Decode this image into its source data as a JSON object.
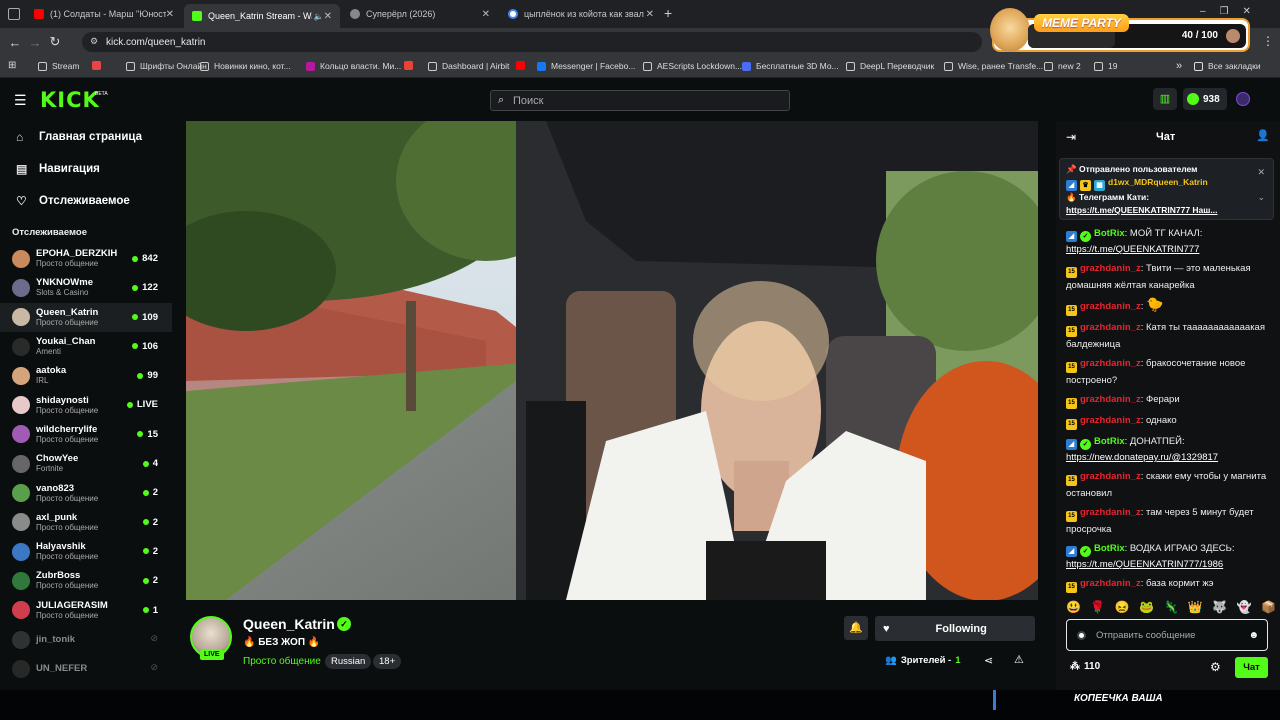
{
  "browser": {
    "tabs": [
      {
        "label": "(1) Солдаты - Марш \"Юность",
        "icon_color": "#ff0000",
        "icon": "youtube-icon"
      },
      {
        "label": "Queen_Katrin Stream - Wat",
        "icon_color": "#53fc18",
        "icon": "kick-icon",
        "active": true
      },
      {
        "label": "Суперёрл (2026)",
        "icon_color": "#888888",
        "icon": "globe-icon"
      },
      {
        "label": "цыплёнок из койота как звали",
        "icon_color": "#4285f4",
        "icon": "google-icon"
      }
    ],
    "new_tab": "+",
    "url": "kick.com/queen_katrin",
    "bookmarks": [
      {
        "label": "Stream",
        "icon": "folder-icon"
      },
      {
        "label": "",
        "icon": "tv-icon",
        "color": "#e84545"
      },
      {
        "label": "Шрифты Онлайн",
        "icon": "folder-icon"
      },
      {
        "label": "Новинки кино, кот...",
        "icon": "film-icon"
      },
      {
        "label": "Кольцо власти. Ми...",
        "icon": "k-icon",
        "color": "#b5179e"
      },
      {
        "label": "",
        "icon": "gmail-icon",
        "color": "#ea4335"
      },
      {
        "label": "Dashboard | Airbit",
        "icon": "airbit-icon"
      },
      {
        "label": "",
        "icon": "youtube-icon",
        "color": "#ff0000"
      },
      {
        "label": "Messenger | Facebo...",
        "icon": "facebook-icon",
        "color": "#1877f2"
      },
      {
        "label": "AEScripts Lockdown...",
        "icon": "ae-icon"
      },
      {
        "label": "Бесплатные 3D Мо...",
        "icon": "3d-icon",
        "color": "#4a6cf7"
      },
      {
        "label": "DeepL Переводчик",
        "icon": "deepl-icon"
      },
      {
        "label": "Wise, ранее Transfe...",
        "icon": "wise-icon"
      },
      {
        "label": "new 2",
        "icon": "folder-icon"
      },
      {
        "label": "19",
        "icon": "folder-icon"
      }
    ],
    "more_bookmarks": "»",
    "all_bookmarks": "Все закладки"
  },
  "meme_widget": {
    "title": "MEME PARTY",
    "progress_text": "40 / 100",
    "progress": 0.4
  },
  "kick": {
    "logo": "KICK",
    "beta": "BETA",
    "search_placeholder": "Поиск",
    "kicks_count": "938",
    "nav": [
      {
        "label": "Главная страница",
        "icon": "home-icon"
      },
      {
        "label": "Навигация",
        "icon": "browse-icon"
      },
      {
        "label": "Отслеживаемое",
        "icon": "heart-icon"
      }
    ],
    "following_header": "Отслеживаемое",
    "following": [
      {
        "name": "EPOHA_DERZKIH",
        "category": "Просто общение",
        "viewers": "842",
        "color": "#c98a5e"
      },
      {
        "name": "YNKNOWme",
        "category": "Slots & Casino",
        "viewers": "122",
        "color": "#6b6b8e"
      },
      {
        "name": "Queen_Katrin",
        "category": "Просто общение",
        "viewers": "109",
        "color": "#c9b8a4",
        "active": true
      },
      {
        "name": "Youkai_Chan",
        "category": "Amenti",
        "viewers": "106",
        "color": "#2a2a2a"
      },
      {
        "name": "aatoka",
        "category": "IRL",
        "viewers": "99",
        "color": "#d4a57a"
      },
      {
        "name": "shidaynosti",
        "category": "Просто общение",
        "viewers": "LIVE",
        "color": "#e7c9c9"
      },
      {
        "name": "wildcherrylife",
        "category": "Просто общение",
        "viewers": "15",
        "color": "#a05bb5"
      },
      {
        "name": "ChowYee",
        "category": "Fortnite",
        "viewers": "4",
        "color": "#666666"
      },
      {
        "name": "vano823",
        "category": "Просто общение",
        "viewers": "2",
        "color": "#5aa04c"
      },
      {
        "name": "axl_punk",
        "category": "Просто общение",
        "viewers": "2",
        "color": "#8a8a8a"
      },
      {
        "name": "Halyavshik",
        "category": "Просто общение",
        "viewers": "2",
        "color": "#3b78c4"
      },
      {
        "name": "ZubrBoss",
        "category": "Просто общение",
        "viewers": "2",
        "color": "#2f7a3a"
      },
      {
        "name": "JULIAGERASIM",
        "category": "Просто общение",
        "viewers": "1",
        "color": "#d03d4d"
      },
      {
        "name": "jin_tonik",
        "category": "",
        "viewers": "",
        "color": "#555555",
        "offline": true
      },
      {
        "name": "UN_NEFER",
        "category": "",
        "viewers": "",
        "color": "#444444",
        "offline": true
      }
    ],
    "stream": {
      "name": "Queen_Katrin",
      "live_badge": "LIVE",
      "title": "🔥 БЕЗ ЖОП 🔥",
      "category": "Просто общение",
      "tags": [
        "Russian",
        "18+"
      ],
      "following_label": "Following",
      "viewers_label": "Зрителей -",
      "viewers_value": "1"
    },
    "chat": {
      "header": "Чат",
      "pinned_label": "Отправлено пользователем",
      "pinned_user": "d1wx_MDRqueen_Katrin",
      "pinned_text": "🔥 Телеграмм Кати:",
      "pinned_link": "https://t.me/QUEENKATRIN777 Наш...",
      "messages": [
        {
          "user": "BotRix",
          "kind": "bot",
          "text": "МОЙ ТГ КАНАЛ:",
          "link": "https://t.me/QUEENKATRIN777"
        },
        {
          "user": "grazhdanin_z",
          "kind": "user",
          "text": "Твити — это маленькая домашняя жёлтая канарейка"
        },
        {
          "user": "grazhdanin_z",
          "kind": "user",
          "text": "",
          "emote": "🐤"
        },
        {
          "user": "grazhdanin_z",
          "kind": "user",
          "text": "Катя ты таааааааааааакая балдежница"
        },
        {
          "user": "grazhdanin_z",
          "kind": "user",
          "text": "бракосочетание новое построено?"
        },
        {
          "user": "grazhdanin_z",
          "kind": "user",
          "text": "Ферари"
        },
        {
          "user": "grazhdanin_z",
          "kind": "user",
          "text": "однако"
        },
        {
          "user": "BotRix",
          "kind": "bot",
          "text": "ДОНАТПЕЙ:",
          "link": "https://new.donatepay.ru/@1329817"
        },
        {
          "user": "grazhdanin_z",
          "kind": "user",
          "text": "скажи ему чтобы у магнита остановил"
        },
        {
          "user": "grazhdanin_z",
          "kind": "user",
          "text": "там через 5 минут будет просрочка"
        },
        {
          "user": "BotRix",
          "kind": "bot",
          "text": "ВОДКА ИГРАЮ ЗДЕСЬ:",
          "link": "https://t.me/QUEENKATRIN777/1986"
        },
        {
          "user": "grazhdanin_z",
          "kind": "user",
          "text": "база кормит жэ"
        }
      ],
      "emotes": [
        "😃",
        "🌹",
        "😖",
        "🐸",
        "🦎",
        "👑",
        "🐺",
        "👻",
        "📦"
      ],
      "input_placeholder": "Отправить сообщение",
      "points": "110",
      "send_label": "Чат"
    }
  },
  "overlay_text": "КОПЕЕЧКА ВАША",
  "colors": {
    "kick_green": "#53fc18",
    "bot_blue": "#2d7dd2",
    "user_red": "#e8242f",
    "badge_yellow": "#f5c518"
  }
}
